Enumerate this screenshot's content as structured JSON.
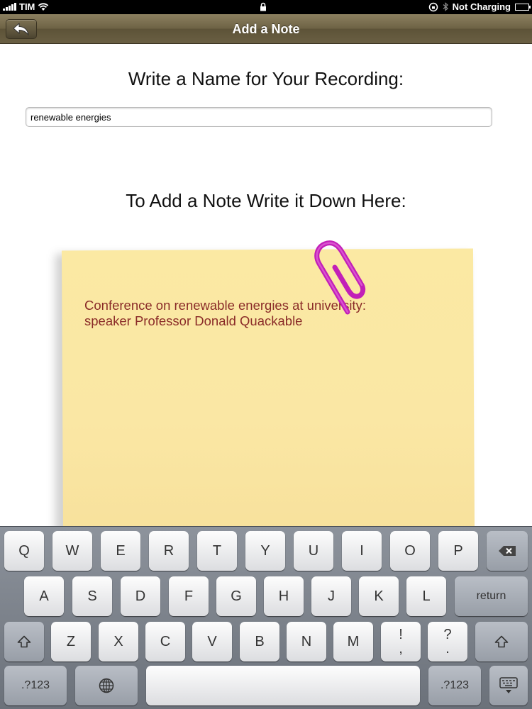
{
  "status_bar": {
    "carrier": "TIM",
    "battery_text": "Not Charging"
  },
  "nav": {
    "title": "Add a Note"
  },
  "form": {
    "name_heading": "Write a Name for Your Recording:",
    "name_value": "renewable energies",
    "note_heading": "To Add a Note Write it Down Here:",
    "note_text": "Conference on renewable energies at university:\nspeaker Professor Donald Quackable"
  },
  "keyboard": {
    "row1": [
      "Q",
      "W",
      "E",
      "R",
      "T",
      "Y",
      "U",
      "I",
      "O",
      "P"
    ],
    "row2": [
      "A",
      "S",
      "D",
      "F",
      "G",
      "H",
      "J",
      "K",
      "L"
    ],
    "row3": [
      "Z",
      "X",
      "C",
      "V",
      "B",
      "N",
      "M"
    ],
    "return_label": "return",
    "numbers_label": ".?123",
    "punct1_top": "!",
    "punct1_bottom": ",",
    "punct2_top": "?",
    "punct2_bottom": "."
  },
  "colors": {
    "nav_bar": "#6e6345",
    "note_paper": "#fae7a4",
    "note_text": "#8a2b28",
    "paperclip": "#c21fb8"
  }
}
